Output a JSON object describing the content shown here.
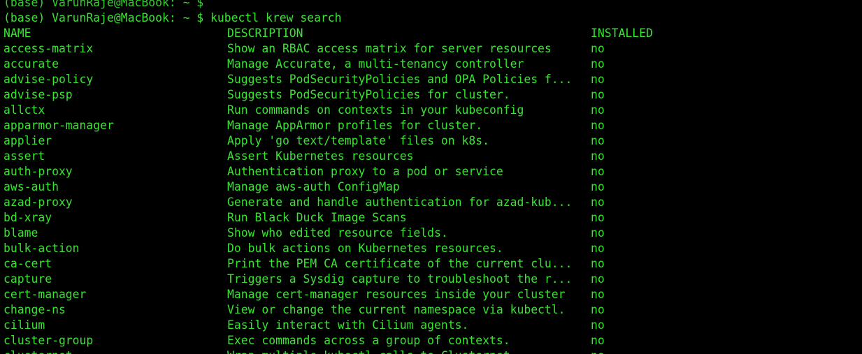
{
  "terminal": {
    "cut_top_line": "(base) VarunRaje@MacBook: ~ $",
    "prompt": "(base) VarunRaje@MacBook: ~ $ ",
    "command": "kubectl krew search",
    "colors": {
      "background": "#000000",
      "text": "#39e332"
    }
  },
  "headers": {
    "name": "NAME",
    "description": "DESCRIPTION",
    "installed": "INSTALLED"
  },
  "rows": [
    {
      "name": "access-matrix",
      "description": "Show an RBAC access matrix for server resources",
      "installed": "no"
    },
    {
      "name": "accurate",
      "description": "Manage Accurate, a multi-tenancy controller",
      "installed": "no"
    },
    {
      "name": "advise-policy",
      "description": "Suggests PodSecurityPolicies and OPA Policies f...",
      "installed": "no"
    },
    {
      "name": "advise-psp",
      "description": "Suggests PodSecurityPolicies for cluster.",
      "installed": "no"
    },
    {
      "name": "allctx",
      "description": "Run commands on contexts in your kubeconfig",
      "installed": "no"
    },
    {
      "name": "apparmor-manager",
      "description": "Manage AppArmor profiles for cluster.",
      "installed": "no"
    },
    {
      "name": "applier",
      "description": "Apply 'go text/template' files on k8s.",
      "installed": "no"
    },
    {
      "name": "assert",
      "description": "Assert Kubernetes resources",
      "installed": "no"
    },
    {
      "name": "auth-proxy",
      "description": "Authentication proxy to a pod or service",
      "installed": "no"
    },
    {
      "name": "aws-auth",
      "description": "Manage aws-auth ConfigMap",
      "installed": "no"
    },
    {
      "name": "azad-proxy",
      "description": "Generate and handle authentication for azad-kub...",
      "installed": "no"
    },
    {
      "name": "bd-xray",
      "description": "Run Black Duck Image Scans",
      "installed": "no"
    },
    {
      "name": "blame",
      "description": "Show who edited resource fields.",
      "installed": "no"
    },
    {
      "name": "bulk-action",
      "description": "Do bulk actions on Kubernetes resources.",
      "installed": "no"
    },
    {
      "name": "ca-cert",
      "description": "Print the PEM CA certificate of the current clu...",
      "installed": "no"
    },
    {
      "name": "capture",
      "description": "Triggers a Sysdig capture to troubleshoot the r...",
      "installed": "no"
    },
    {
      "name": "cert-manager",
      "description": "Manage cert-manager resources inside your cluster",
      "installed": "no"
    },
    {
      "name": "change-ns",
      "description": "View or change the current namespace via kubectl.",
      "installed": "no"
    },
    {
      "name": "cilium",
      "description": "Easily interact with Cilium agents.",
      "installed": "no"
    },
    {
      "name": "cluster-group",
      "description": "Exec commands across a group of contexts.",
      "installed": "no"
    },
    {
      "name": "clusternet",
      "description": "Wrap multiple kubectl calls to Clusternet",
      "installed": "no"
    }
  ]
}
